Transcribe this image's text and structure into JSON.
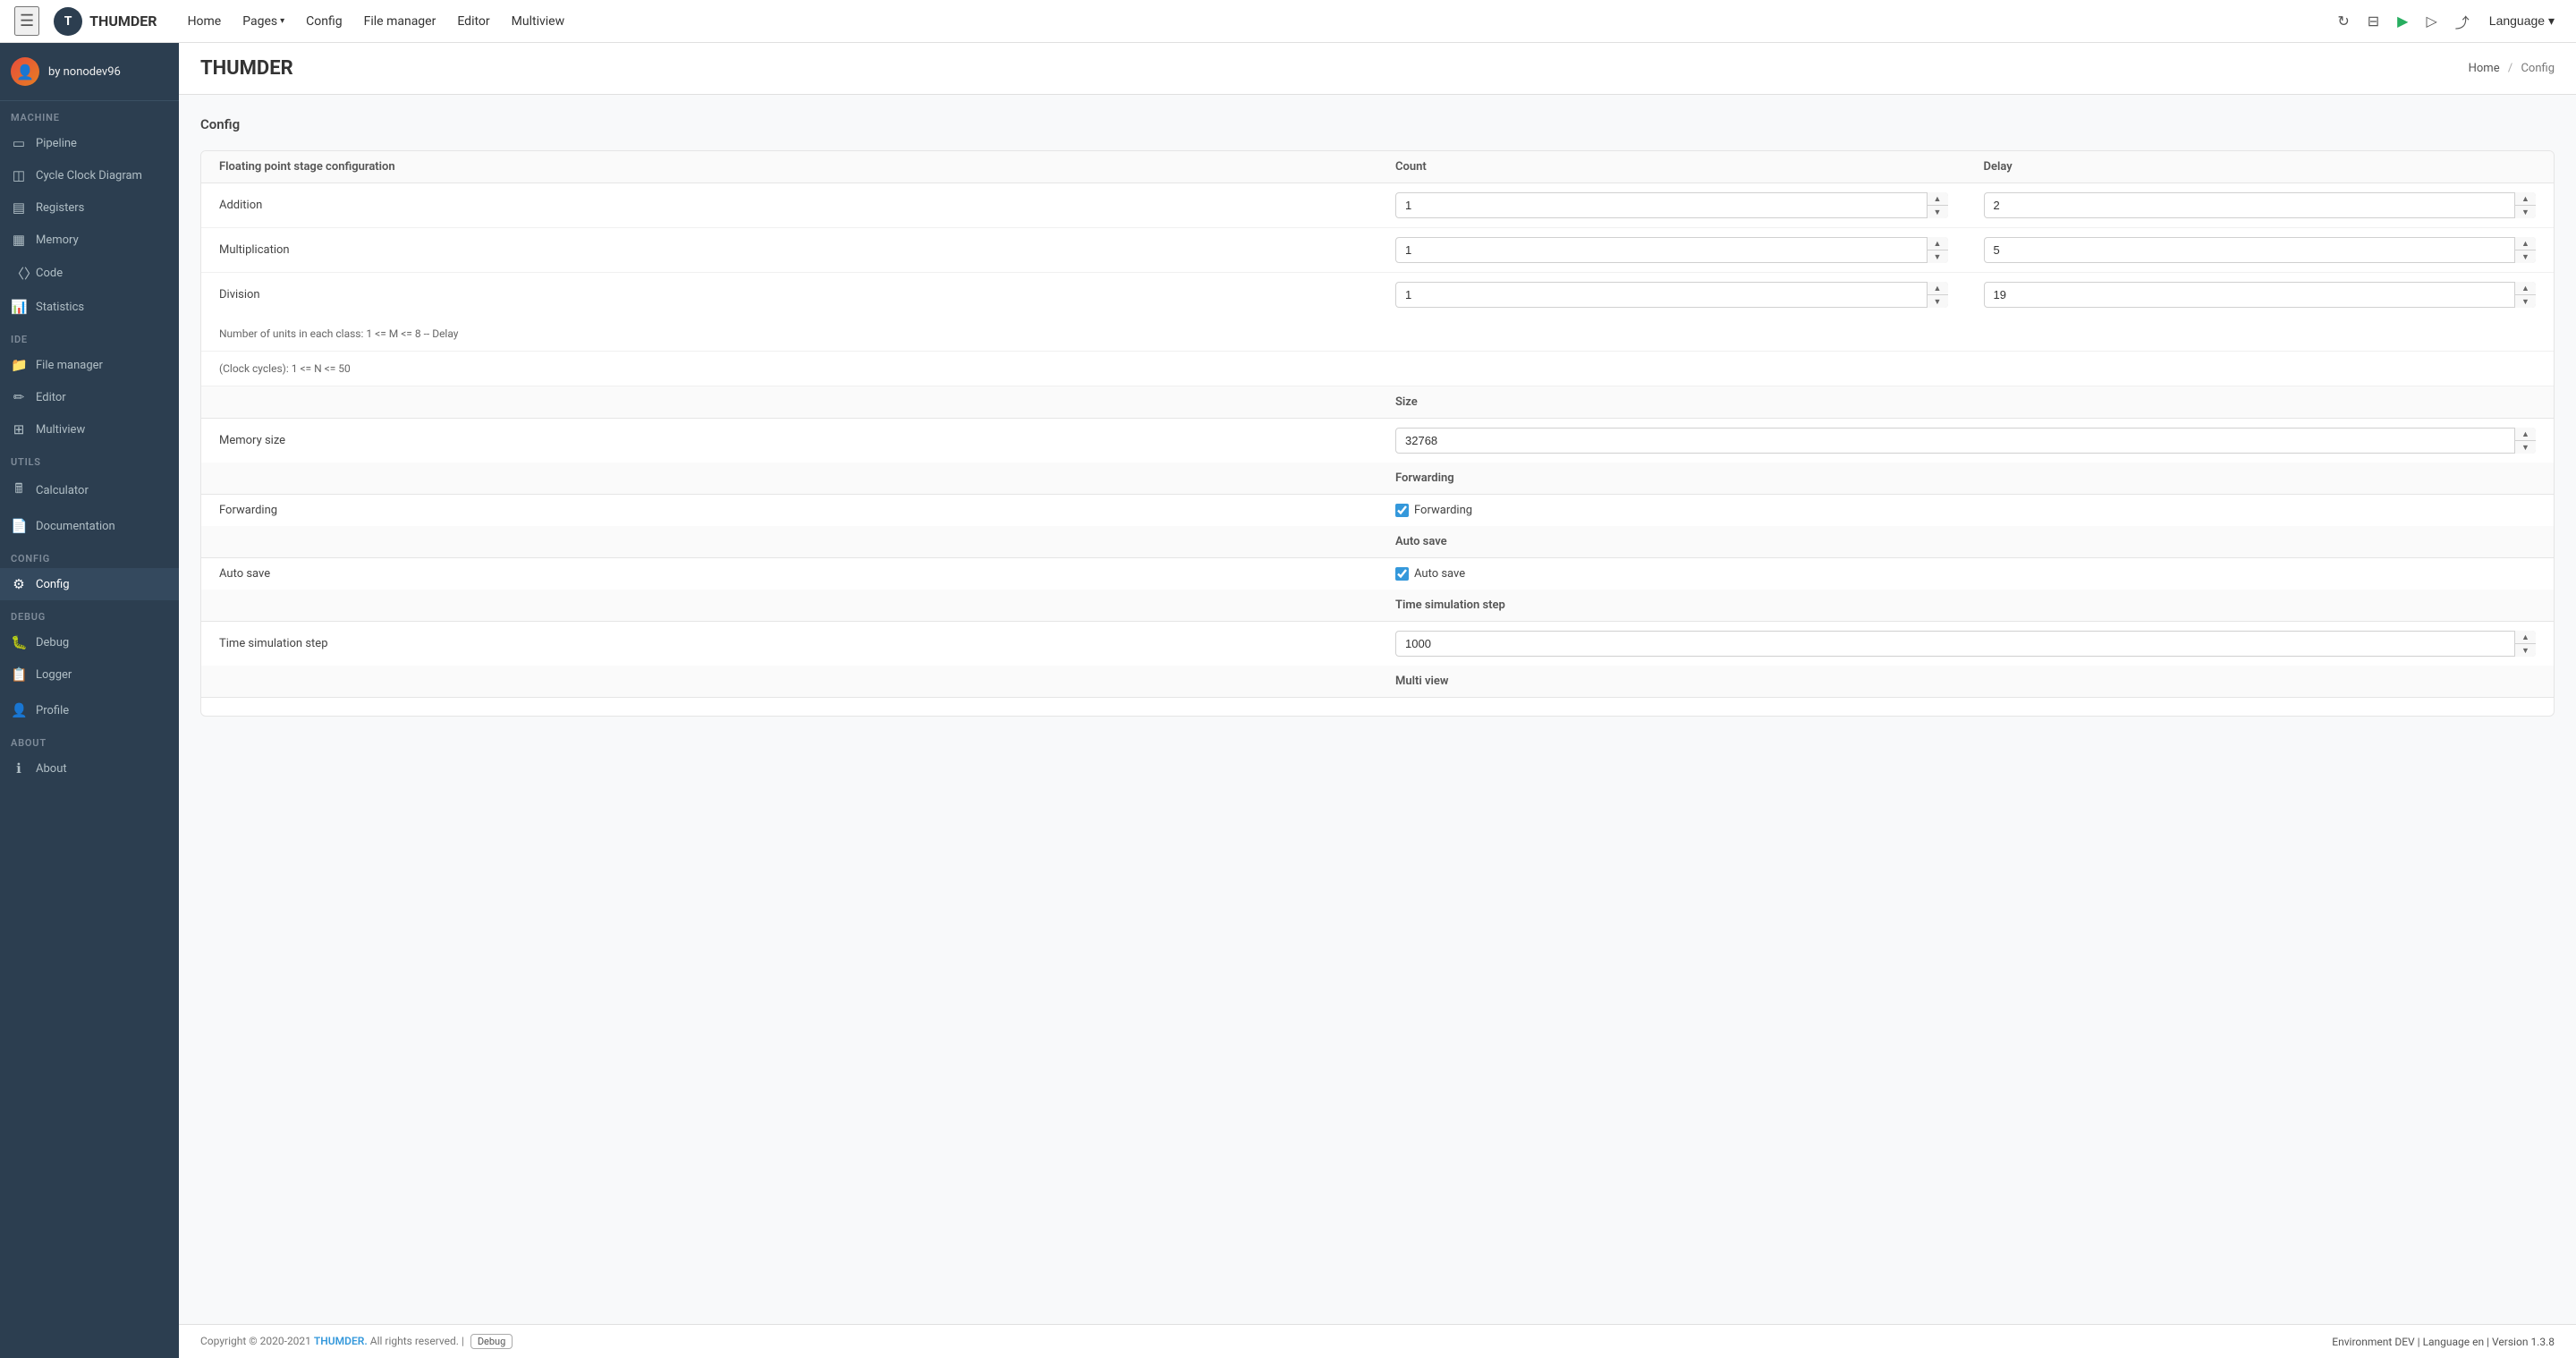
{
  "app": {
    "name": "THUMDER",
    "logo_text": "T"
  },
  "navbar": {
    "hamburger_label": "☰",
    "links": [
      {
        "id": "home",
        "label": "Home",
        "has_dropdown": false
      },
      {
        "id": "pages",
        "label": "Pages",
        "has_dropdown": true
      },
      {
        "id": "config",
        "label": "Config",
        "has_dropdown": false,
        "active": true
      },
      {
        "id": "file-manager",
        "label": "File manager",
        "has_dropdown": false
      },
      {
        "id": "editor",
        "label": "Editor",
        "has_dropdown": false
      },
      {
        "id": "multiview",
        "label": "Multiview",
        "has_dropdown": false
      }
    ],
    "icons": {
      "refresh": "↻",
      "save": "⊟",
      "play": "▶",
      "step": "▷",
      "export": "⤴"
    },
    "language_btn": "Language ▾"
  },
  "sidebar": {
    "user": {
      "name": "by nonodev96",
      "avatar": "👤"
    },
    "sections": [
      {
        "label": "Machine",
        "items": [
          {
            "id": "pipeline",
            "label": "Pipeline",
            "icon": "⬜"
          },
          {
            "id": "cycle-clock-diagram",
            "label": "Cycle Clock Diagram",
            "icon": "⬜"
          },
          {
            "id": "registers",
            "label": "Registers",
            "icon": "⬜"
          },
          {
            "id": "memory",
            "label": "Memory",
            "icon": "⬜"
          },
          {
            "id": "code",
            "label": "Code",
            "icon": "⬜"
          },
          {
            "id": "statistics",
            "label": "Statistics",
            "icon": "⬜"
          }
        ]
      },
      {
        "label": "IDE",
        "items": [
          {
            "id": "file-manager",
            "label": "File manager",
            "icon": "⬜"
          },
          {
            "id": "editor",
            "label": "Editor",
            "icon": "⬜"
          },
          {
            "id": "multiview",
            "label": "Multiview",
            "icon": "⬜"
          }
        ]
      },
      {
        "label": "Utils",
        "items": [
          {
            "id": "calculator",
            "label": "Calculator",
            "icon": "⬜"
          },
          {
            "id": "documentation",
            "label": "Documentation",
            "icon": "⬜"
          }
        ]
      },
      {
        "label": "Config",
        "items": [
          {
            "id": "config",
            "label": "Config",
            "icon": "⚙",
            "active": true
          }
        ]
      },
      {
        "label": "DEBUG",
        "items": [
          {
            "id": "debug",
            "label": "Debug",
            "icon": "⬜"
          },
          {
            "id": "logger",
            "label": "Logger",
            "icon": "⬜"
          }
        ]
      },
      {
        "label": "",
        "items": [
          {
            "id": "profile",
            "label": "Profile",
            "icon": "⬜"
          }
        ]
      },
      {
        "label": "About",
        "items": [
          {
            "id": "about",
            "label": "About",
            "icon": "⬜"
          }
        ]
      }
    ]
  },
  "page": {
    "title": "THUMDER",
    "breadcrumb": {
      "home": "Home",
      "sep": "/",
      "current": "Config"
    },
    "section_label": "Config"
  },
  "config": {
    "fp_section_title": "Floating point stage configuration",
    "count_header": "Count",
    "delay_header": "Delay",
    "rows": [
      {
        "label": "Addition",
        "count": "1",
        "delay": "2"
      },
      {
        "label": "Multiplication",
        "count": "1",
        "delay": "5"
      },
      {
        "label": "Division",
        "count": "1",
        "delay": "19"
      }
    ],
    "info1": "Number of units in each class: 1 <= M <= 8 -- Delay",
    "info2": "(Clock cycles): 1 <= N <= 50",
    "size_header": "Size",
    "memory_size_label": "Memory size",
    "memory_size_value": "32768",
    "forwarding_header": "Forwarding",
    "forwarding_label": "Forwarding",
    "forwarding_row_label": "Forwarding",
    "forwarding_checked": true,
    "auto_save_header": "Auto save",
    "auto_save_label": "Auto save",
    "auto_save_row_label": "Auto save",
    "auto_save_checked": true,
    "time_sim_step_header": "Time simulation step",
    "time_sim_step_label": "Time simulation step",
    "time_sim_step_value": "1000",
    "multi_view_header": "Multi view"
  },
  "footer": {
    "copyright": "Copyright © 2020-2021",
    "brand": "THUMDER.",
    "rights": "All rights reserved.",
    "pipe_sep": "|",
    "debug_label": "Debug",
    "environment_label": "Environment",
    "environment_value": "DEV",
    "language_label": "Language",
    "language_value": "en",
    "version_label": "Version",
    "version_value": "1.3.8"
  }
}
